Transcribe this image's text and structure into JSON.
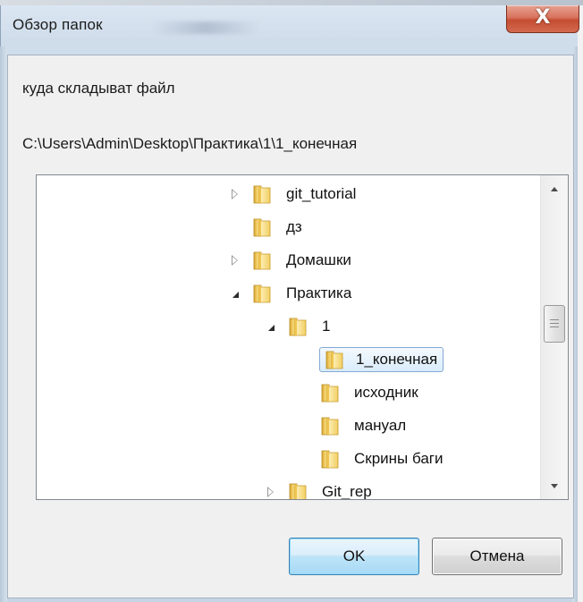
{
  "window": {
    "title": "Обзор папок",
    "close_glyph": "X"
  },
  "dialog": {
    "description": "куда складыват файл",
    "selected_path": "C:\\Users\\Admin\\Desktop\\Практика\\1\\1_конечная"
  },
  "tree": {
    "items": [
      {
        "label": "git_tutorial",
        "expander": "collapsed",
        "level": 0
      },
      {
        "label": "дз",
        "expander": "none",
        "level": 0
      },
      {
        "label": "Домашки",
        "expander": "collapsed",
        "level": 0
      },
      {
        "label": "Практика",
        "expander": "expanded",
        "level": 0
      },
      {
        "label": "1",
        "expander": "expanded",
        "level": 1
      },
      {
        "label": "1_конечная",
        "expander": "none",
        "level": 2,
        "selected": true
      },
      {
        "label": "исходник",
        "expander": "none",
        "level": 2
      },
      {
        "label": "мануал",
        "expander": "none",
        "level": 2
      },
      {
        "label": "Скрины баги",
        "expander": "none",
        "level": 2
      },
      {
        "label": "Git_rep",
        "expander": "collapsed",
        "level": 1
      }
    ]
  },
  "buttons": {
    "ok_label": "OK",
    "cancel_label": "Отмена"
  },
  "icons": {
    "folder": "folder-icon",
    "collapsed": "expand-arrow-icon",
    "expanded": "collapse-arrow-icon",
    "scroll_up": "scroll-up-icon",
    "scroll_down": "scroll-down-icon"
  },
  "colors": {
    "selection_border": "#7da2ce",
    "ok_button_border": "#3c7fb1",
    "close_button": "#c44d32"
  }
}
